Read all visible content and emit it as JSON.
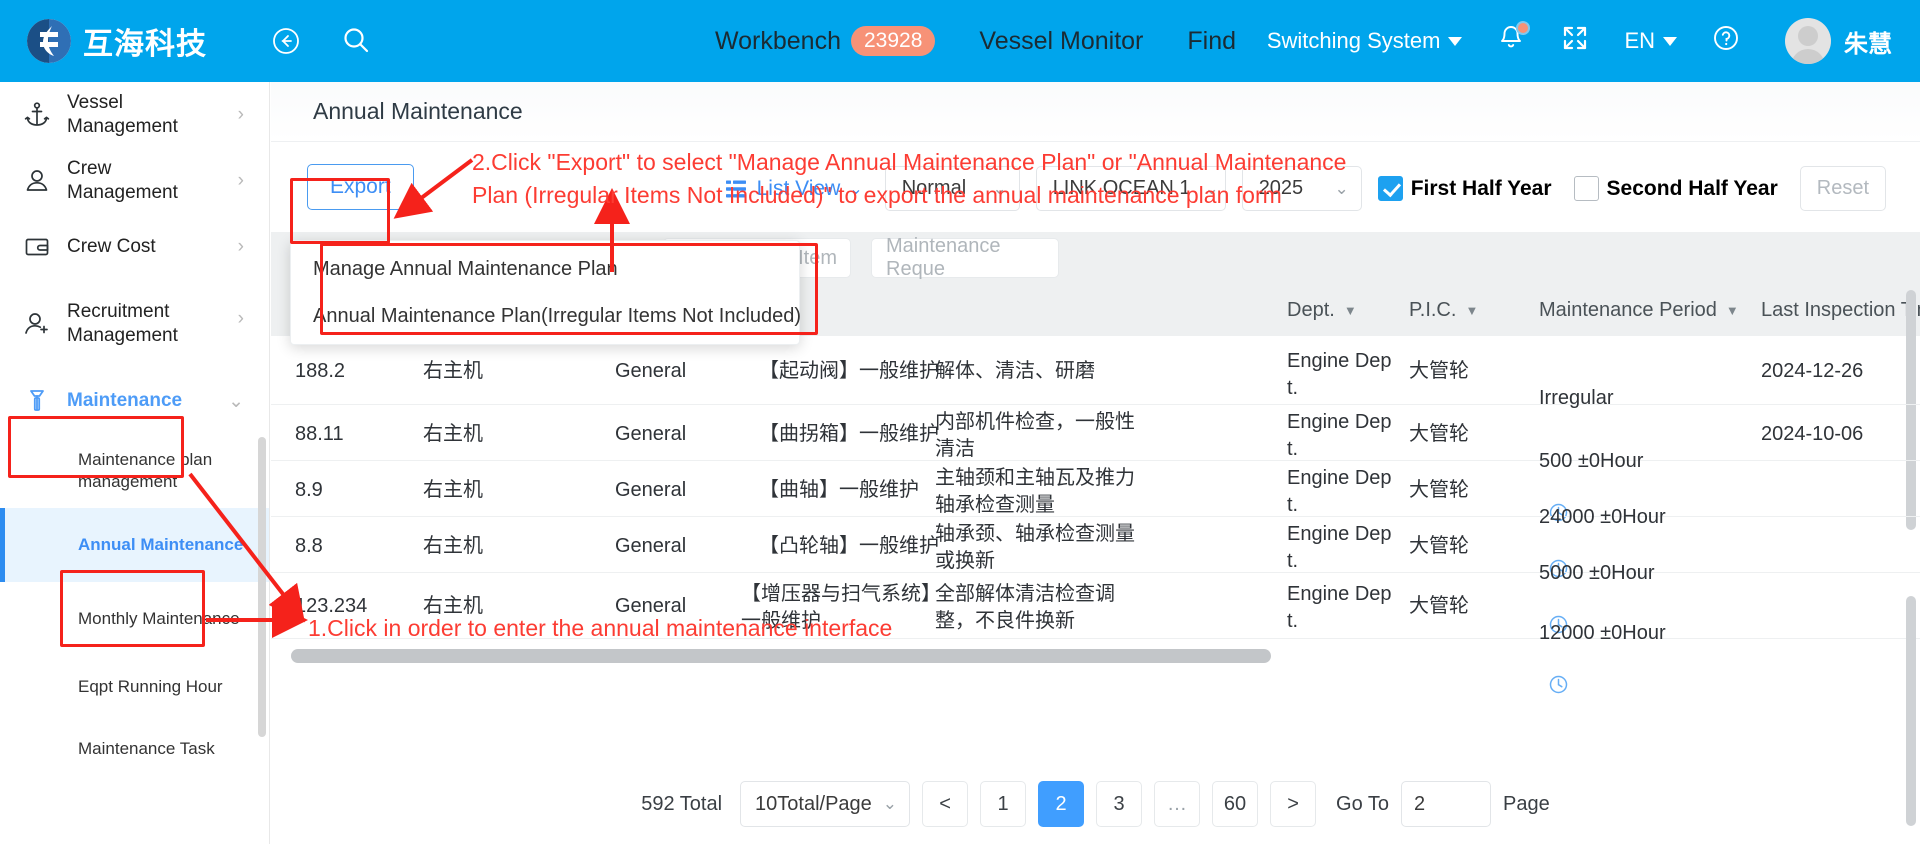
{
  "topbar": {
    "brand": "互海科技",
    "logo_icon": "company-logo-icon",
    "back_icon": "back-arrow-icon",
    "search_icon": "search-icon",
    "nav": [
      {
        "label": "Workbench",
        "badge": "23928"
      },
      {
        "label": "Vessel Monitor",
        "badge": ""
      },
      {
        "label": "Find",
        "badge": ""
      }
    ],
    "switching_system": "Switching System",
    "bell_icon": "notification-bell-icon",
    "fullscreen_icon": "fullscreen-icon",
    "language": "EN",
    "help_icon": "help-circle-icon",
    "user_name": "朱慧",
    "bg_color": "#00a5ec",
    "badge_color": "#f79277"
  },
  "sidebar": {
    "items": [
      {
        "label": "Vessel Management",
        "icon": "anchor-icon",
        "chevron": "›",
        "active": false
      },
      {
        "label": "Crew Management",
        "icon": "person-icon",
        "chevron": "›",
        "active": false
      },
      {
        "label": "Crew Cost",
        "icon": "wallet-icon",
        "chevron": "›",
        "active": false
      },
      {
        "label": "Recruitment Management",
        "icon": "person-add-icon",
        "chevron": "›",
        "active": false
      },
      {
        "label": "Maintenance",
        "icon": "hammer-icon",
        "chevron": "⌄",
        "active": true
      }
    ],
    "sub_items": [
      {
        "label": "Maintenance plan management",
        "current": false
      },
      {
        "label": "Annual Maintenance",
        "current": true
      },
      {
        "label": "Monthly Maintenance",
        "current": false
      },
      {
        "label": "Eqpt Running Hour",
        "current": false
      },
      {
        "label": "Maintenance Task",
        "current": false
      }
    ]
  },
  "page": {
    "title": "Annual Maintenance"
  },
  "toolbar": {
    "export_label": "Export",
    "export_menu": [
      "Manage Annual Maintenance Plan",
      "Annual Maintenance Plan(Irregular Items Not Included)"
    ],
    "list_view_label": "List View",
    "list_view_icon": "list-view-icon",
    "normal_select": "Normal",
    "vessel_select": "LINK OCEAN 1",
    "year_select": "2025",
    "first_half_year": "First Half Year",
    "first_half_year_checked": true,
    "second_half_year": "Second Half Year",
    "second_half_year_checked": false,
    "reset_label": "Reset"
  },
  "filters": {
    "maintenance_item_placeholder": "Maintenance Item",
    "maintenance_reque_placeholder": "Maintenance Reque"
  },
  "table": {
    "columns": [
      {
        "label": "",
        "caret": false
      },
      {
        "label": "",
        "caret": false
      },
      {
        "label": "",
        "caret": false
      },
      {
        "label": "",
        "caret": false
      },
      {
        "label": "",
        "caret": false
      },
      {
        "label": "Dept.",
        "caret": true
      },
      {
        "label": "P.I.C.",
        "caret": true
      },
      {
        "label": "Maintenance Period",
        "caret": true
      },
      {
        "label": "Last Inspection Tim",
        "caret": false
      }
    ],
    "rows": [
      {
        "no": "188.2",
        "equipment": "右主机",
        "type": "General",
        "item": "【起动阀】一般维护",
        "requirement": "解体、清洁、研磨",
        "dept": "Engine Dep\nt.",
        "pic": "大管轮",
        "period": "Irregular",
        "period_clock": false,
        "last_inspection": "2024-12-26"
      },
      {
        "no": "88.11",
        "equipment": "右主机",
        "type": "General",
        "item": "【曲拐箱】一般维护",
        "requirement": "内部机件检查，一般性\n清洁",
        "dept": "Engine Dep\nt.",
        "pic": "大管轮",
        "period": "500 ±0Hour",
        "period_clock": true,
        "last_inspection": "2024-10-06"
      },
      {
        "no": "8.9",
        "equipment": "右主机",
        "type": "General",
        "item": "【曲轴】一般维护",
        "requirement": "主轴颈和主轴瓦及推力\n轴承检查测量",
        "dept": "Engine Dep\nt.",
        "pic": "大管轮",
        "period": "24000 ±0Hour",
        "period_clock": true,
        "last_inspection": ""
      },
      {
        "no": "8.8",
        "equipment": "右主机",
        "type": "General",
        "item": "【凸轮轴】一般维护",
        "requirement": "轴承颈、轴承检查测量\n或换新",
        "dept": "Engine Dep\nt.",
        "pic": "大管轮",
        "period": "5000 ±0Hour",
        "period_clock": true,
        "last_inspection": ""
      },
      {
        "no": "123.234",
        "equipment": "右主机",
        "type": "General",
        "item": "【增压器与扫气系统】\n一般维护",
        "requirement": "全部解体清洁检查调\n整，不良件换新",
        "dept": "Engine Dep\nt.",
        "pic": "大管轮",
        "period": "12000 ±0Hour",
        "period_clock": true,
        "last_inspection": ""
      }
    ]
  },
  "pagination": {
    "total_label": "592 Total",
    "page_size": "10Total/Page",
    "prev": "<",
    "pages": [
      "1",
      "2",
      "3",
      "…",
      "60"
    ],
    "current_page": "2",
    "next": ">",
    "goto_label": "Go To",
    "goto_value": "2",
    "page_label": "Page"
  },
  "annotations": {
    "step1": "1.Click in order to enter the annual maintenance interface",
    "step2": "2.Click \"Export\" to select \"Manage Annual Maintenance Plan\" or \"Annual Maintenance\nPlan (Irregular Items Not Included)\" to export the annual maintenance plan form",
    "color": "#fc3c33"
  }
}
